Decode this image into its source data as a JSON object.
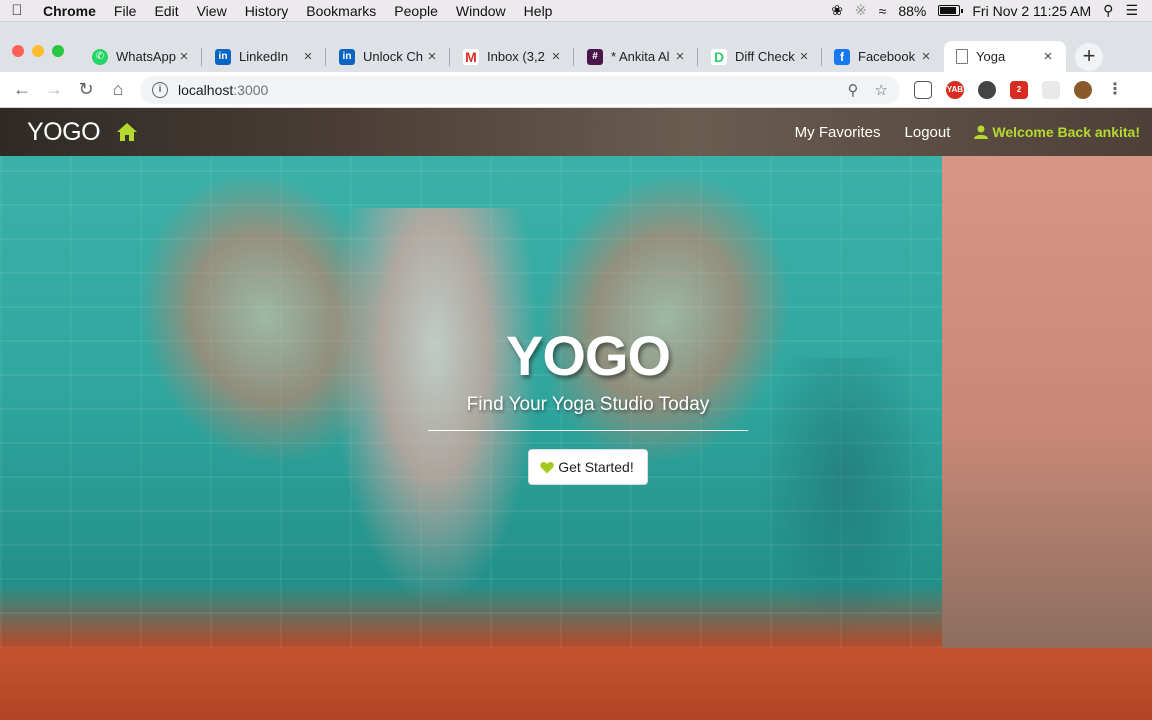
{
  "menubar": {
    "items": [
      "Chrome",
      "File",
      "Edit",
      "View",
      "History",
      "Bookmarks",
      "People",
      "Window",
      "Help"
    ],
    "battery": "88%",
    "datetime": "Fri Nov 2  11:25 AM"
  },
  "tabs": [
    {
      "title": "WhatsApp",
      "icon": "whatsapp-icon",
      "color": "#25d366"
    },
    {
      "title": "LinkedIn",
      "icon": "linkedin-icon",
      "color": "#0a66c2"
    },
    {
      "title": "Unlock Ch",
      "icon": "linkedin-icon",
      "color": "#0a66c2"
    },
    {
      "title": "Inbox (3,2",
      "icon": "gmail-icon",
      "color": "#d93025"
    },
    {
      "title": "* Ankita Al",
      "icon": "slack-icon",
      "color": "#4a154b"
    },
    {
      "title": "Diff Check",
      "icon": "diffchecker-icon",
      "color": "#2ecc71"
    },
    {
      "title": "Facebook",
      "icon": "facebook-icon",
      "color": "#1877f2"
    },
    {
      "title": "Yoga",
      "icon": "page-icon",
      "color": "#ffffff"
    }
  ],
  "address": {
    "host": "localhost",
    "port": ":3000"
  },
  "app": {
    "brand": "YOGO",
    "nav": {
      "favorites": "My Favorites",
      "logout": "Logout",
      "welcome": "Welcome Back ankita!"
    },
    "accent": "#b6d930"
  },
  "hero": {
    "title": "YOGO",
    "subtitle": "Find Your Yoga Studio Today",
    "cta": "Get Started!"
  }
}
